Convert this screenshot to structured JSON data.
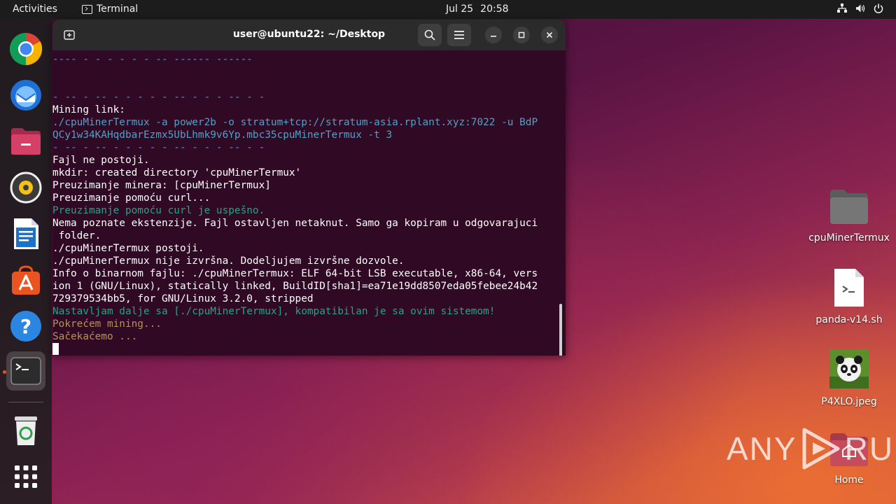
{
  "topbar": {
    "activities": "Activities",
    "app_name": "Terminal",
    "date": "Jul 25",
    "time": "20:58",
    "tray_icons": [
      "network-icon",
      "volume-icon",
      "power-icon"
    ]
  },
  "dock": {
    "items": [
      "chrome-icon",
      "thunderbird-icon",
      "files-icon",
      "rhythmbox-icon",
      "writer-icon",
      "app-center-icon",
      "help-icon",
      "terminal-icon",
      "trash-icon",
      "app-grid-icon"
    ],
    "active_item": "terminal-icon"
  },
  "terminal": {
    "title": "user@ubuntu22: ~/Desktop",
    "lines": [
      "---- - - - - - - -- ------ ------",
      "- -- - -- - - - - - -- - - - -- - -",
      "Mining link:",
      "./cpuMinerTermux -a power2b -o stratum+tcp://stratum-asia.rplant.xyz:7022 -u BdP",
      "QCy1w34KAHqdbarEzmx5UbLhmk9v6Yp.mbc35cpuMinerTermux -t 3",
      "- -- - -- - - - - - -- - - - -- - -",
      "Fajl ne postoji.",
      "mkdir: created directory 'cpuMinerTermux'",
      "Preuzimanje minera: [cpuMinerTermux]",
      "Preuzimanje pomoću curl...",
      "Preuzimanje pomoću curl je uspešno.",
      "Nema poznate ekstenzije. Fajl ostavljen netaknut. Samo ga kopiram u odgovarajuci",
      " folder.",
      "./cpuMinerTermux postoji.",
      "./cpuMinerTermux nije izvršna. Dodeljujem izvršne dozvole.",
      "Info o binarnom fajlu: ./cpuMinerTermux: ELF 64-bit LSB executable, x86-64, vers",
      "ion 1 (GNU/Linux), statically linked, BuildID[sha1]=ea71e19dd8507eda05febee24b42",
      "729379534bb5, for GNU/Linux 3.2.0, stripped",
      "Nastavljam dalje sa [./cpuMinerTermux], kompatibilan je sa ovim sistemom!",
      "Pokrećem mining...",
      "Sačekaćemo ..."
    ],
    "colors": {
      "separator": "#5e8ccf",
      "command": "#4da2c7",
      "success": "#26a286",
      "progress": "#b7925a"
    }
  },
  "desktop": {
    "icons": [
      {
        "label": "cpuMinerTermux",
        "icon": "folder-icon"
      },
      {
        "label": "panda-v14.sh",
        "icon": "script-file-icon"
      },
      {
        "label": "P4XLO.jpeg",
        "icon": "image-file-icon"
      },
      {
        "label": "Home",
        "icon": "home-folder-icon"
      }
    ]
  },
  "watermark": "ANY RUN"
}
